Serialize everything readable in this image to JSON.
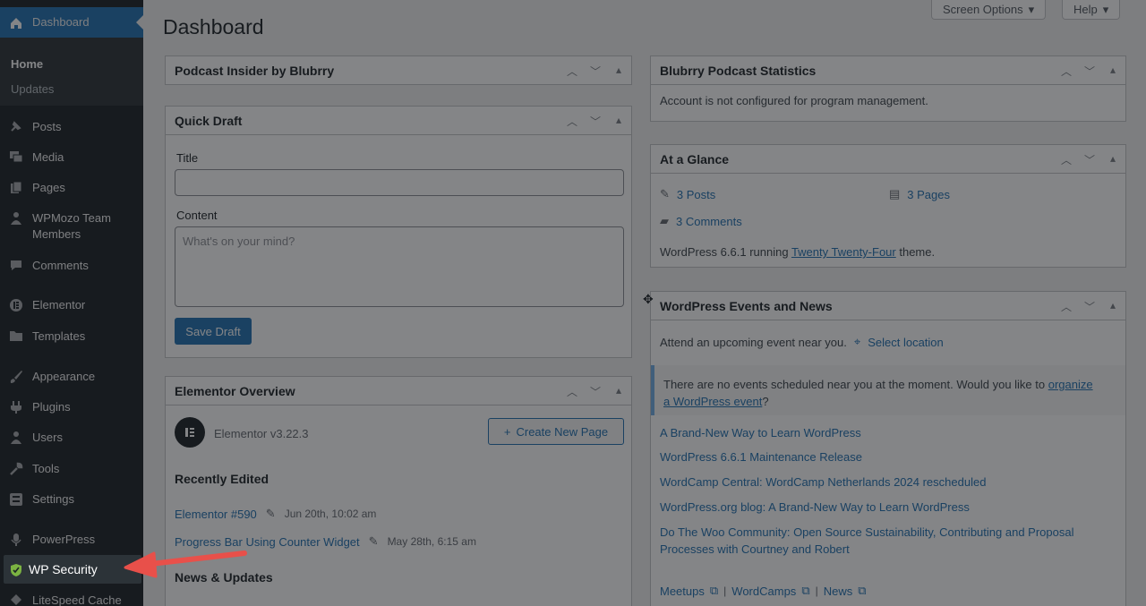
{
  "sidebar": {
    "dashboard_label": "Dashboard",
    "submenu": {
      "home": "Home",
      "updates": "Updates"
    },
    "items": [
      {
        "label": "Posts",
        "icon": "pushpin-icon"
      },
      {
        "label": "Media",
        "icon": "media-icon"
      },
      {
        "label": "Pages",
        "icon": "pages-icon"
      },
      {
        "label": "WPMozo Team Members",
        "icon": "person-icon"
      },
      {
        "label": "Comments",
        "icon": "comment-icon"
      },
      {
        "label": "Elementor",
        "icon": "elementor-icon"
      },
      {
        "label": "Templates",
        "icon": "folder-icon"
      },
      {
        "label": "Appearance",
        "icon": "brush-icon"
      },
      {
        "label": "Plugins",
        "icon": "plug-icon"
      },
      {
        "label": "Users",
        "icon": "user-icon"
      },
      {
        "label": "Tools",
        "icon": "wrench-icon"
      },
      {
        "label": "Settings",
        "icon": "sliders-icon"
      },
      {
        "label": "PowerPress",
        "icon": "microphone-icon"
      },
      {
        "label": "WP Security",
        "icon": "shield-icon"
      },
      {
        "label": "LiteSpeed Cache",
        "icon": "diamond-icon"
      }
    ]
  },
  "header": {
    "screen_options": "Screen Options",
    "help": "Help",
    "title": "Dashboard"
  },
  "widgets": {
    "podcast_insider": {
      "title": "Podcast Insider by Blubrry"
    },
    "quick_draft": {
      "title": "Quick Draft",
      "title_label": "Title",
      "content_label": "Content",
      "content_placeholder": "What's on your mind?",
      "save_button": "Save Draft"
    },
    "elementor_overview": {
      "title": "Elementor Overview",
      "version": "Elementor v3.22.3",
      "create_button": "Create New Page",
      "recently_edited": "Recently Edited",
      "edits": [
        {
          "title": "Elementor #590",
          "date": "Jun 20th, 10:02 am"
        },
        {
          "title": "Progress Bar Using Counter Widget",
          "date": "May 28th, 6:15 am"
        }
      ],
      "news_heading": "News & Updates"
    },
    "blubrry_stats": {
      "title": "Blubrry Podcast Statistics",
      "message": "Account is not configured for program management."
    },
    "at_a_glance": {
      "title": "At a Glance",
      "posts": "3 Posts",
      "pages": "3 Pages",
      "comments": "3 Comments",
      "running_prefix": "WordPress 6.6.1 running ",
      "theme_link": "Twenty Twenty-Four",
      "running_suffix": " theme."
    },
    "events_news": {
      "title": "WordPress Events and News",
      "attend_text": "Attend an upcoming event near you.",
      "select_location": "Select location",
      "notice_prefix": "There are no events scheduled near you at the moment. Would you like to ",
      "notice_link_1": "organize",
      "notice_link_2": "a WordPress event",
      "notice_suffix": "?",
      "news": [
        "A Brand-New Way to Learn WordPress",
        "WordPress 6.6.1 Maintenance Release",
        "WordCamp Central: WordCamp Netherlands 2024 rescheduled",
        "WordPress.org blog: A Brand-New Way to Learn WordPress",
        "Do The Woo Community: Open Source Sustainability, Contributing and Proposal",
        "Processes with Courtney and Robert"
      ],
      "footer_links": [
        "Meetups",
        "WordCamps",
        "News"
      ],
      "separator": "|"
    }
  },
  "colors": {
    "sidebar_bg": "#1d2327",
    "accent": "#2271b1",
    "arrow": "#e8504a",
    "shield": "#7cb342"
  }
}
